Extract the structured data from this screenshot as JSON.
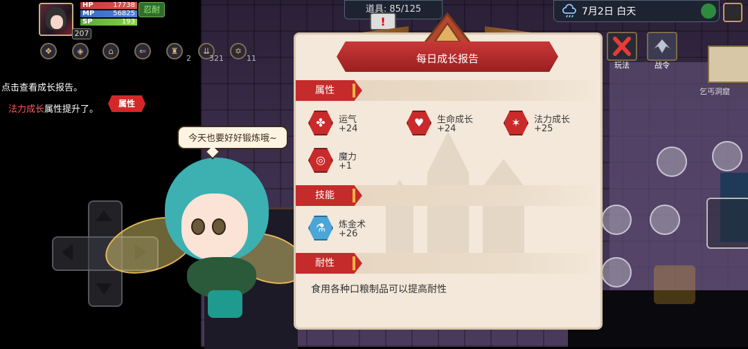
{
  "player": {
    "hp_label": "HP",
    "hp_value": "17738",
    "mp_label": "MP",
    "mp_value": "56825",
    "sp_label": "SP",
    "sp_value": "193",
    "patience_label": "忍耐",
    "level": "207"
  },
  "buffs": [
    {
      "icon": "scroll-icon",
      "count": ""
    },
    {
      "icon": "shield-icon",
      "count": ""
    },
    {
      "icon": "house-icon",
      "count": ""
    },
    {
      "icon": "arrow-icon",
      "count": ""
    },
    {
      "icon": "armor-icon",
      "count": "2"
    },
    {
      "icon": "down-arrows-icon",
      "count": "321"
    },
    {
      "icon": "star-circle-icon",
      "count": "11"
    }
  ],
  "log": {
    "line1": "点击查看成长报告。",
    "line2_highlight": "法力成长",
    "line2_rest": "属性提升了。",
    "badge": "属性"
  },
  "fairy": {
    "speech": "今天也要好好锻炼哦~"
  },
  "hud": {
    "items": "道具: 85/125",
    "alert": "!",
    "date": "7月2日  白天",
    "play_label": "玩法",
    "battle_label": "战令",
    "cave_label": "乞丐洞窟"
  },
  "report": {
    "title": "每日成长报告",
    "sections": {
      "attributes": "属性",
      "skills": "技能",
      "durability": "耐性"
    },
    "attributes": [
      {
        "name": "运气",
        "value": "+24",
        "icon": "clover-icon"
      },
      {
        "name": "生命成长",
        "value": "+24",
        "icon": "heart-icon"
      },
      {
        "name": "法力成长",
        "value": "+25",
        "icon": "magic-star-icon"
      },
      {
        "name": "魔力",
        "value": "+1",
        "icon": "swirl-icon"
      }
    ],
    "skills": [
      {
        "name": "炼金术",
        "value": "+26",
        "icon": "flask-icon"
      }
    ],
    "durability_text": "食用各种口粮制品可以提高耐性"
  },
  "colors": {
    "accent_red": "#c52b2b",
    "panel_bg": "#f3e8da",
    "skill_blue": "#4aa6d8"
  }
}
